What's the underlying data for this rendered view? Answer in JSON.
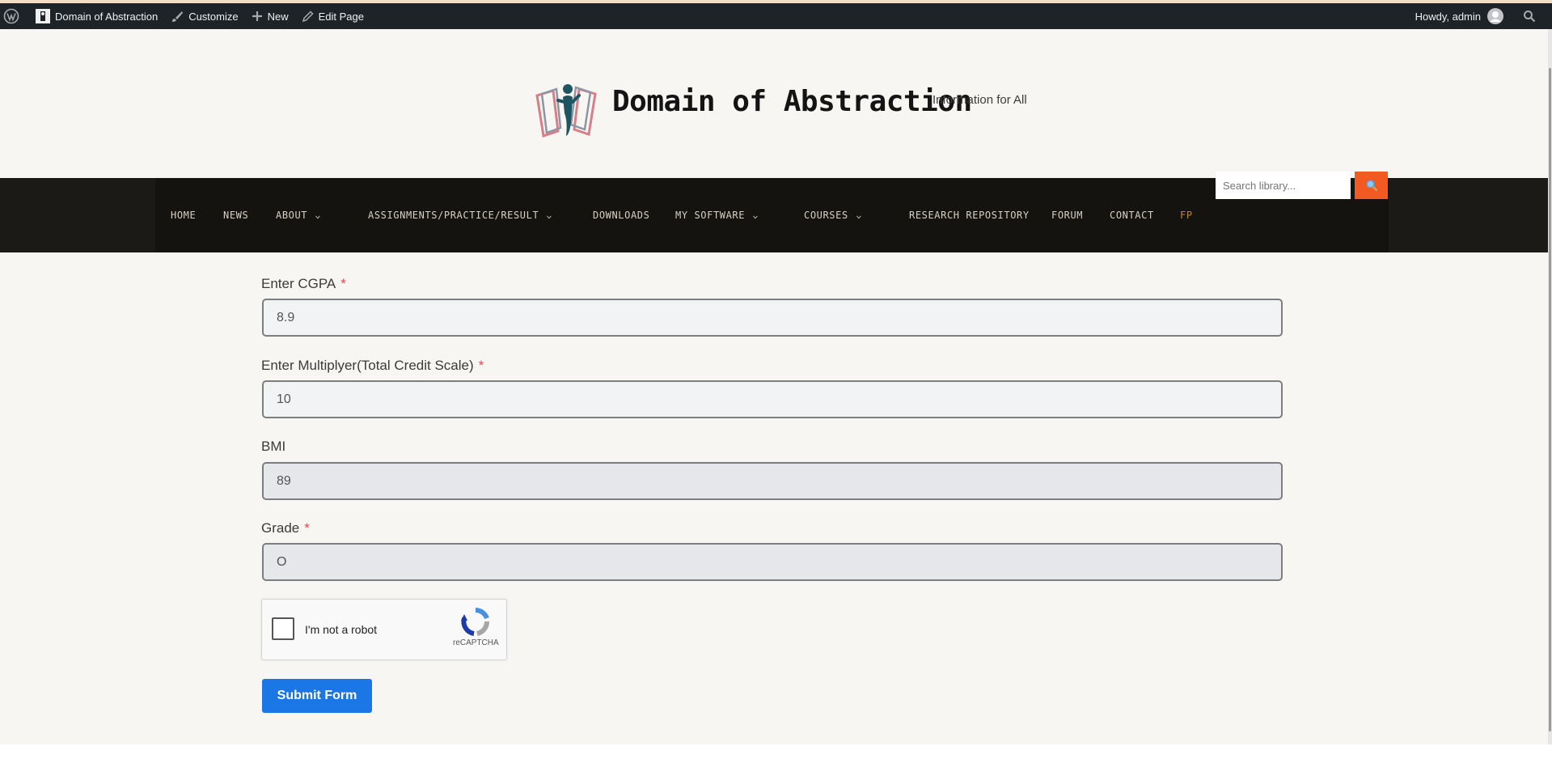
{
  "colors": {
    "admin_bar": "#1d2327",
    "nav_background": "#15130f",
    "nav_active": "#b8863b",
    "search_button": "#f25a22",
    "submit_button": "#1b77e6",
    "required_marker": "#e5484d",
    "page_background": "#f8f6f2"
  },
  "admin_bar": {
    "wp_logo_icon": "wordpress-icon",
    "site_name": "Domain of Abstraction",
    "customize": "Customize",
    "new": "New",
    "edit_page": "Edit Page",
    "greeting": "Howdy, admin",
    "search_icon": "search-icon"
  },
  "site": {
    "title": "Domain of Abstraction",
    "tagline": "Information for All"
  },
  "nav": {
    "items": [
      {
        "label": "HOME",
        "dropdown": false
      },
      {
        "label": "NEWS",
        "dropdown": false
      },
      {
        "label": "ABOUT",
        "dropdown": true
      },
      {
        "label": "ASSIGNMENTS/PRACTICE/RESULT",
        "dropdown": true
      },
      {
        "label": "DOWNLOADS",
        "dropdown": false
      },
      {
        "label": "MY SOFTWARE",
        "dropdown": true
      },
      {
        "label": "COURSES",
        "dropdown": true
      },
      {
        "label": "RESEARCH REPOSITORY",
        "dropdown": false
      },
      {
        "label": "FORUM",
        "dropdown": false
      },
      {
        "label": "CONTACT",
        "dropdown": false
      },
      {
        "label": "FP",
        "dropdown": false,
        "active": true
      }
    ],
    "search_placeholder": "Search library...",
    "search_button_icon": "magnifier-icon"
  },
  "form": {
    "fields": [
      {
        "label": "Enter CGPA",
        "required": "*",
        "value": "8.9"
      },
      {
        "label": "Enter Multiplyer(Total Credit Scale)",
        "required": "*",
        "value": "10"
      },
      {
        "label": "BMI",
        "value": "89",
        "readonly": true
      },
      {
        "label": "Grade",
        "required": "*",
        "value": "O",
        "readonly": true
      }
    ],
    "captcha": {
      "label": "I'm not a robot",
      "brand": "reCAPTCHA",
      "checked": false
    },
    "submit_label": "Submit Form"
  }
}
